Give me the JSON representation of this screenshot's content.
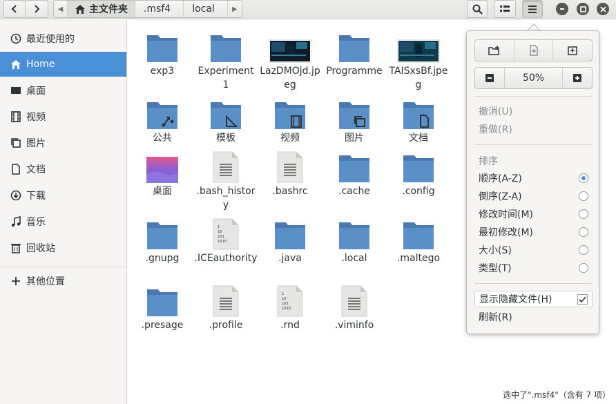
{
  "header": {
    "path_home": "主文件夹",
    "path_seg1": ".msf4",
    "path_seg2": "local"
  },
  "sidebar": {
    "items": [
      {
        "label": "最近使用的",
        "icon": "clock-icon"
      },
      {
        "label": "Home",
        "icon": "home-icon"
      },
      {
        "label": "桌面",
        "icon": "desktop-icon"
      },
      {
        "label": "视频",
        "icon": "film-icon"
      },
      {
        "label": "图片",
        "icon": "image-icon"
      },
      {
        "label": "文档",
        "icon": "document-icon"
      },
      {
        "label": "下载",
        "icon": "download-icon"
      },
      {
        "label": "音乐",
        "icon": "music-icon"
      },
      {
        "label": "回收站",
        "icon": "trash-icon"
      },
      {
        "label": "其他位置",
        "icon": "plus-icon"
      }
    ]
  },
  "files": [
    {
      "name": "exp3",
      "type": "folder"
    },
    {
      "name": "Experiment 1",
      "type": "folder"
    },
    {
      "name": "LazDMOjd.jpeg",
      "type": "image"
    },
    {
      "name": "Programme",
      "type": "folder"
    },
    {
      "name": "TAISxsBf.jpeg",
      "type": "image"
    },
    {
      "name": "公共",
      "type": "folder-share"
    },
    {
      "name": "模板",
      "type": "folder-template"
    },
    {
      "name": "视频",
      "type": "folder-video"
    },
    {
      "name": "图片",
      "type": "folder-picture"
    },
    {
      "name": "文档",
      "type": "folder-document"
    },
    {
      "name": "桌面",
      "type": "desktop"
    },
    {
      "name": ".bash_history",
      "type": "text"
    },
    {
      "name": ".bashrc",
      "type": "text"
    },
    {
      "name": ".cache",
      "type": "folder"
    },
    {
      "name": ".config",
      "type": "folder"
    },
    {
      "name": ".gnupg",
      "type": "folder"
    },
    {
      "name": ".ICEauthority",
      "type": "binary"
    },
    {
      "name": ".java",
      "type": "folder"
    },
    {
      "name": ".local",
      "type": "folder"
    },
    {
      "name": ".maltego",
      "type": "folder"
    },
    {
      "name": ".presage",
      "type": "folder"
    },
    {
      "name": ".profile",
      "type": "text"
    },
    {
      "name": ".rnd",
      "type": "binary"
    },
    {
      "name": ".viminfo",
      "type": "text"
    }
  ],
  "menu": {
    "zoom": "50%",
    "undo": "撤消(U)",
    "redo": "重做(R)",
    "sort_header": "排序",
    "sort_options": [
      {
        "label": "顺序(A-Z)",
        "selected": true
      },
      {
        "label": "倒序(Z-A)",
        "selected": false
      },
      {
        "label": "修改时间(M)",
        "selected": false
      },
      {
        "label": "最初修改(M)",
        "selected": false
      },
      {
        "label": "大小(S)",
        "selected": false
      },
      {
        "label": "类型(T)",
        "selected": false
      }
    ],
    "show_hidden": "显示隐藏文件(H)",
    "show_hidden_checked": true,
    "refresh": "刷新(R)"
  },
  "status": "选中了\".msf4\"（含有 7 项）",
  "colors": {
    "accent": "#4a90d9",
    "folder": "#5b8fc8"
  }
}
